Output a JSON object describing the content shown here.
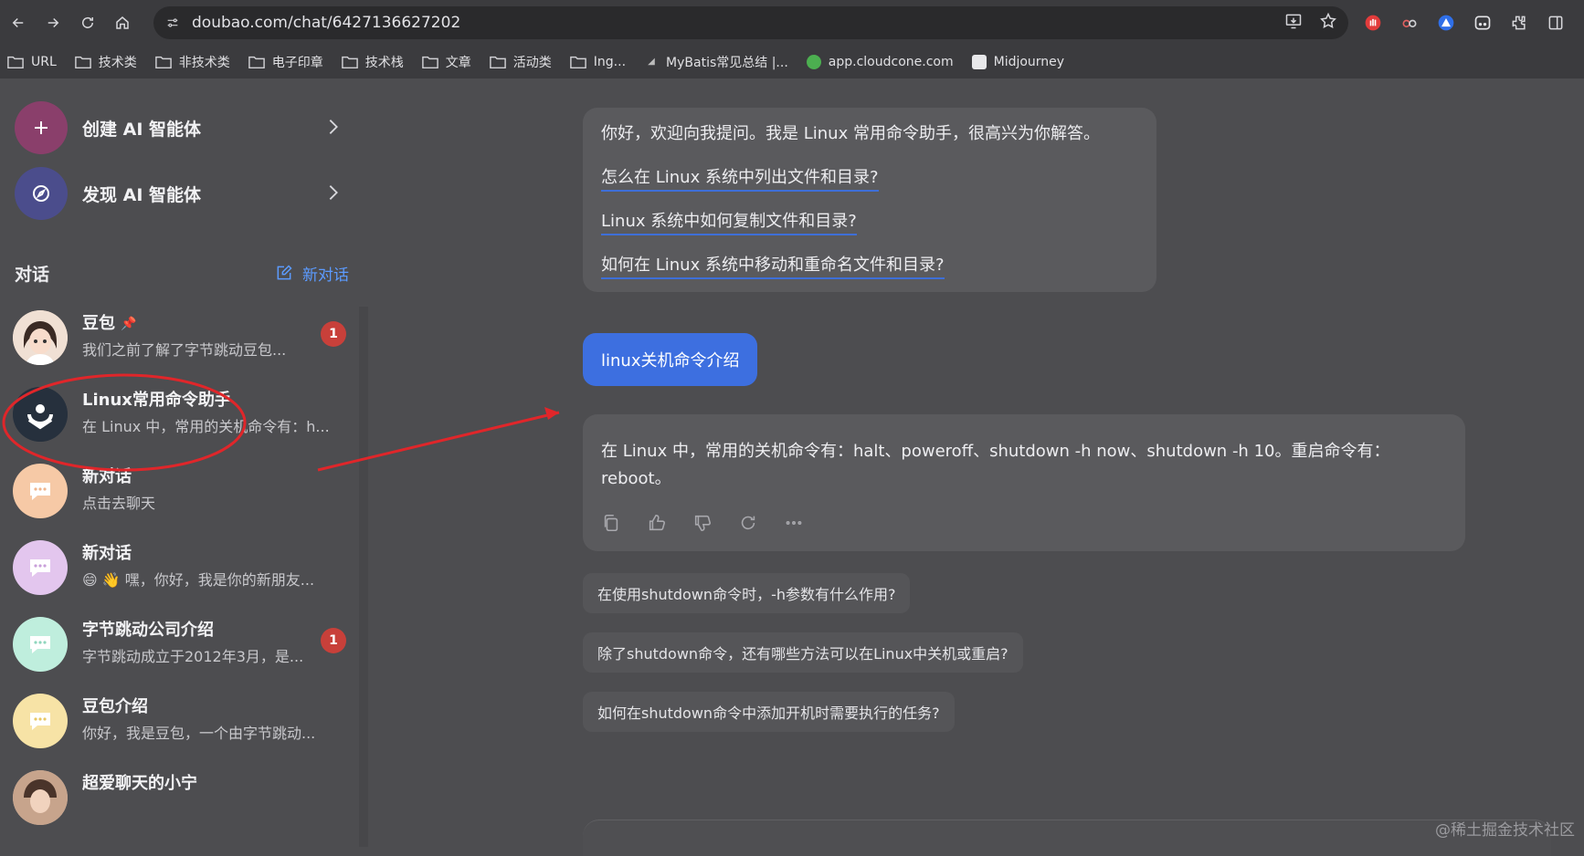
{
  "browser": {
    "url": "doubao.com/chat/6427136627202",
    "bookmarks": [
      {
        "label": "URL",
        "icon": "folder-icon"
      },
      {
        "label": "技术类",
        "icon": "folder-icon"
      },
      {
        "label": "非技术类",
        "icon": "folder-icon"
      },
      {
        "label": "电子印章",
        "icon": "folder-icon"
      },
      {
        "label": "技术栈",
        "icon": "folder-icon"
      },
      {
        "label": "文章",
        "icon": "folder-icon"
      },
      {
        "label": "活动类",
        "icon": "folder-icon"
      },
      {
        "label": "Ing...",
        "icon": "folder-icon"
      },
      {
        "label": "MyBatis常见总结 |...",
        "icon": "site-icon"
      },
      {
        "label": "app.cloudcone.com",
        "icon": "site-icon"
      },
      {
        "label": "Midjourney",
        "icon": "site-icon"
      }
    ]
  },
  "sidebar": {
    "create_agent": "创建 AI 智能体",
    "discover_agent": "发现 AI 智能体",
    "section_title": "对话",
    "new_chat": "新对话",
    "conversations": [
      {
        "title": "豆包",
        "preview": "我们之前了解了字节跳动豆包...",
        "badge": "1",
        "pinned": true
      },
      {
        "title": "Linux常用命令助手",
        "preview": "在 Linux 中，常用的关机命令有：h...",
        "badge": ""
      },
      {
        "title": "新对话",
        "preview": "点击去聊天",
        "badge": ""
      },
      {
        "title": "新对话",
        "preview": "😄 👋 嘿，你好，我是你的新朋友...",
        "badge": ""
      },
      {
        "title": "字节跳动公司介绍",
        "preview": "字节跳动成立于2012年3月，是...",
        "badge": "1"
      },
      {
        "title": "豆包介绍",
        "preview": "你好，我是豆包，一个由字节跳动...",
        "badge": ""
      },
      {
        "title": "超爱聊天的小宁",
        "preview": "",
        "badge": ""
      }
    ]
  },
  "chat": {
    "greeting": "你好，欢迎向我提问。我是 Linux 常用命令助手，很高兴为你解答。",
    "suggested_questions": [
      "怎么在 Linux 系统中列出文件和目录?",
      "Linux 系统中如何复制文件和目录?",
      "如何在 Linux 系统中移动和重命名文件和目录?"
    ],
    "user_message": "linux关机命令介绍",
    "answer": "在 Linux 中，常用的关机命令有：halt、poweroff、shutdown -h now、shutdown -h 10。重启命令有：reboot。",
    "follow_ups": [
      "在使用shutdown命令时，-h参数有什么作用?",
      "除了shutdown命令，还有哪些方法可以在Linux中关机或重启?",
      "如何在shutdown命令中添加开机时需要执行的任务?"
    ]
  },
  "watermark": "@稀土掘金技术社区",
  "colors": {
    "accent": "#3d6fe0",
    "link_underline": "#3e6fd8",
    "badge": "#c8403a",
    "annotation": "#e0262a"
  }
}
